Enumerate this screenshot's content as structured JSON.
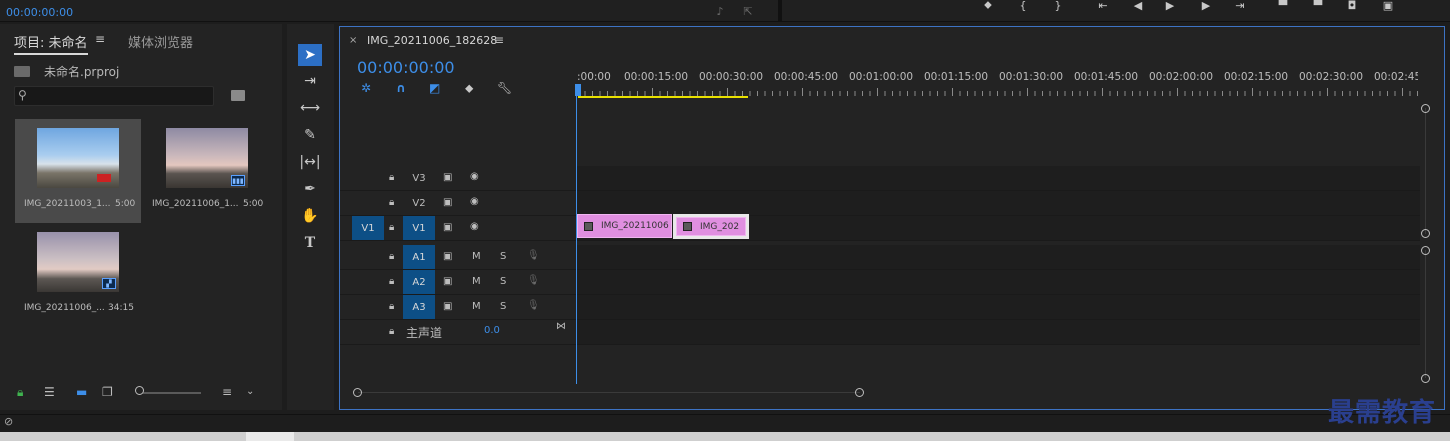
{
  "top": {
    "timecode": "00:00:00:00"
  },
  "project_panel": {
    "tab_project": "项目: 未命名",
    "tab_project_menu": "≡",
    "tab_media": "媒体浏览器",
    "file_name": "未命名.prproj",
    "search_placeholder": "",
    "items": [
      {
        "name": "IMG_20211003_1...",
        "duration": "5:00",
        "selected": true
      },
      {
        "name": "IMG_20211006_1...",
        "duration": "5:00",
        "selected": false
      },
      {
        "name": "IMG_20211006_...",
        "duration": "34:15",
        "selected": false
      }
    ]
  },
  "sequence": {
    "close": "×",
    "title": "IMG_20211006_182628",
    "menu": "≡",
    "timecode": "00:00:00:00",
    "ruler_labels": [
      ":00:00",
      "00:00:15:00",
      "00:00:30:00",
      "00:00:45:00",
      "00:01:00:00",
      "00:01:15:00",
      "00:01:30:00",
      "00:01:45:00",
      "00:02:00:00",
      "00:02:15:00",
      "00:02:30:00",
      "00:02:45:"
    ],
    "tracks": {
      "v3": "V3",
      "v2": "V2",
      "v1_source": "V1",
      "v1": "V1",
      "a1": "A1",
      "a2": "A2",
      "a3": "A3",
      "mute": "M",
      "solo": "S"
    },
    "master_label": "主声道",
    "master_value": "0.0",
    "clips": [
      {
        "name": "IMG_20211006"
      },
      {
        "name": "IMG_202"
      }
    ]
  },
  "watermark": "最需教育",
  "colors": {
    "accent": "#3d8ee8",
    "clip": "#e08fe0",
    "track_blue": "#0d4f86",
    "work_area": "#e8e000"
  }
}
